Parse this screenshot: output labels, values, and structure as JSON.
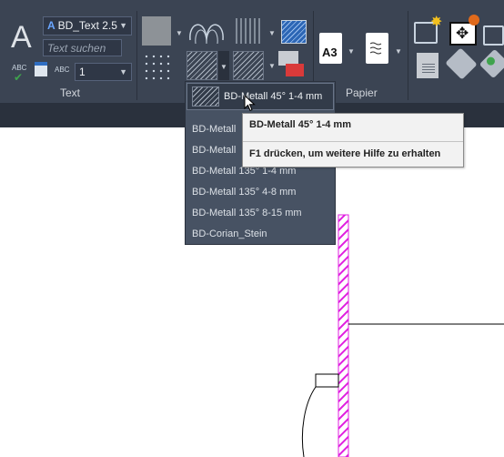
{
  "text_panel": {
    "label": "Text",
    "style_name": "BD_Text 2.5",
    "search_placeholder": "Text suchen",
    "scale_value": "1",
    "spell_check_label": "ABC"
  },
  "paper_panel": {
    "label": "Papier",
    "paper_size": "A3"
  },
  "hatch_dropdown": {
    "selected": "BD-Metall 45° 1-4 mm",
    "items": [
      "BD-Metall 45° 4-8 mm",
      "BD-Metall 45° 8-15 mm",
      "BD-Metall 135° 1-4 mm",
      "BD-Metall 135° 4-8 mm",
      "BD-Metall 135° 8-15 mm",
      "BD-Corian_Stein"
    ],
    "item_2_truncated": "BD-Metall",
    "item_1_truncated": "BD-Metall"
  },
  "tooltip": {
    "title": "BD-Metall 45° 1-4 mm",
    "hint": "F1 drücken, um weitere Hilfe zu erhalten"
  },
  "colors": {
    "ribbon_bg": "#3b4453",
    "hatch_magenta": "#e020e0",
    "tooltip_bg": "#f2f2f2"
  },
  "icons": [
    "text-A-icon",
    "hatch-icon",
    "paper-a3-icon",
    "page-icon",
    "star-icon",
    "move-icon",
    "tag-icon"
  ]
}
